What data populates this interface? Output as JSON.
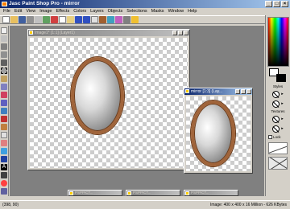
{
  "app": {
    "title": "Jasc Paint Shop Pro - mirror"
  },
  "menu": [
    "File",
    "Edit",
    "View",
    "Image",
    "Effects",
    "Colors",
    "Layers",
    "Objects",
    "Selections",
    "Masks",
    "Window",
    "Help"
  ],
  "doc_main": {
    "title": "Image1* [1:1] (Layer1)"
  },
  "doc_mirror": {
    "title": "mirror [1:3] (Lay..."
  },
  "minimized": [
    {
      "title": "PSPPICT..."
    },
    {
      "title": "PSPPICT..."
    },
    {
      "title": "PSPPICT..."
    }
  ],
  "panel": {
    "styles_label": "Styles",
    "textures_label": "Textures",
    "lock_label": "Lock"
  },
  "status": {
    "coords": "(398, 90)",
    "info": "Image: 400 x 400 x 16 Million - 626 KBytes"
  },
  "colors": {
    "foreground": "#ffffff",
    "background": "#000000",
    "frame": "#a0643a"
  },
  "icons": [
    "app-icon",
    "minimize-icon",
    "maximize-icon",
    "close-icon"
  ]
}
